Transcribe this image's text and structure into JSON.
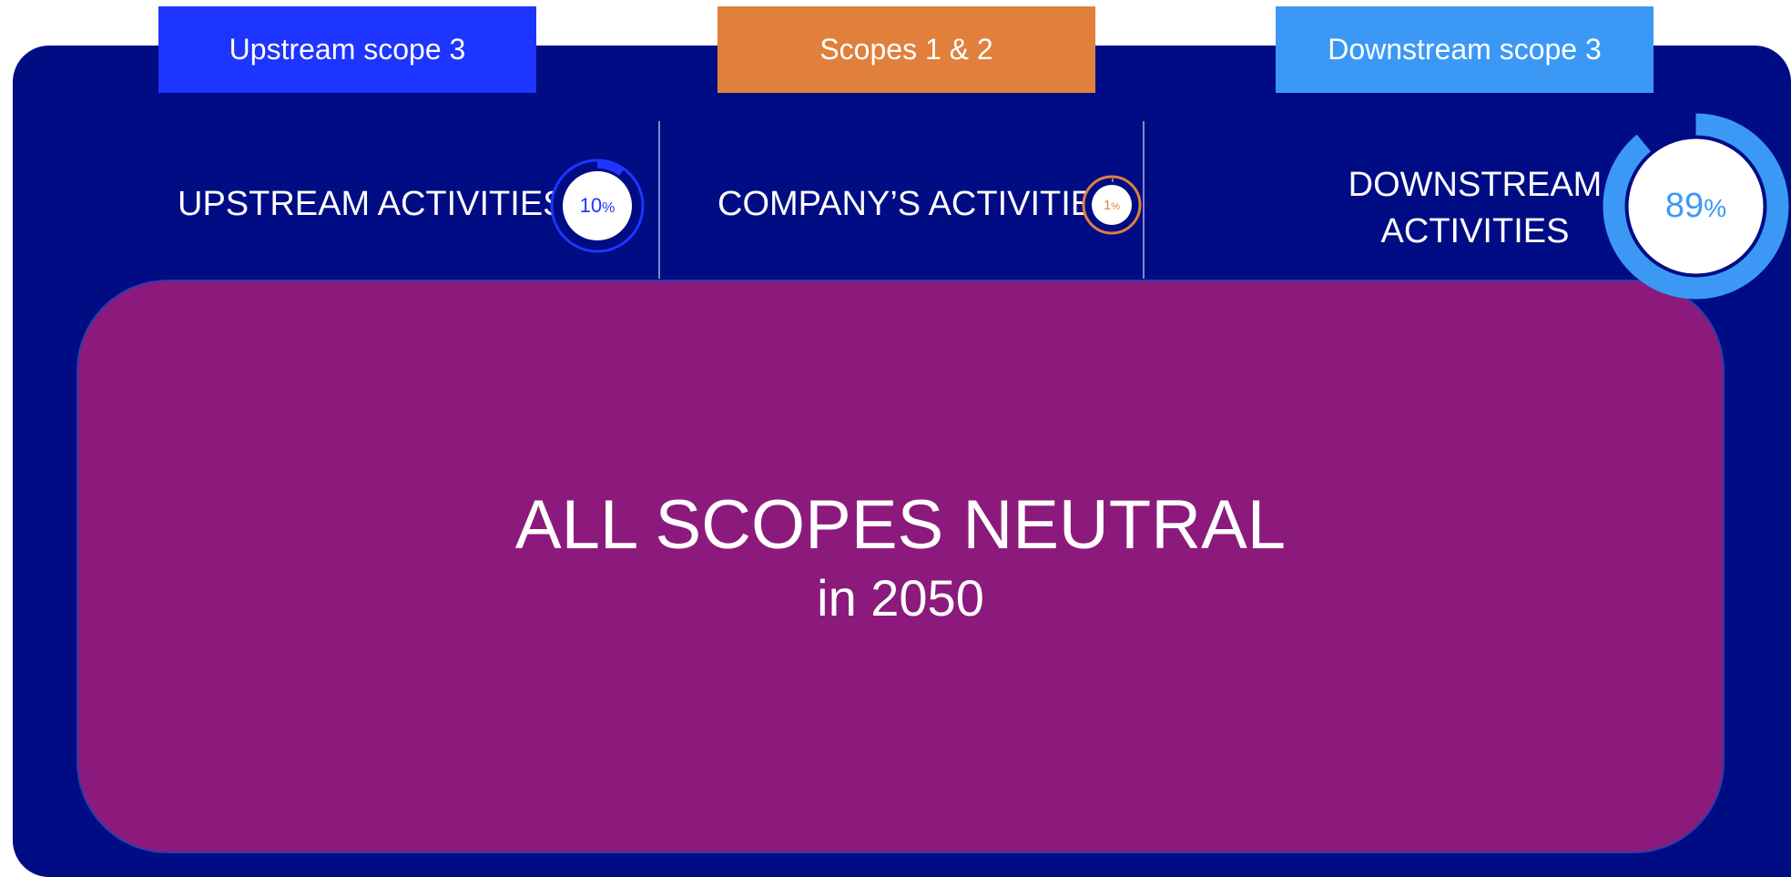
{
  "tabs": {
    "upstream": "Upstream scope 3",
    "company": "Scopes 1 & 2",
    "downstream": "Downstream scope 3"
  },
  "activities": {
    "upstream": {
      "label": "UPSTREAM ACTIVITIES",
      "value": "10",
      "unit": "%",
      "share": 0.1
    },
    "company": {
      "label": "COMPANY’S ACTIVITIES",
      "value": "1",
      "unit": "%",
      "share": 0.01
    },
    "downstream": {
      "label": "DOWNSTREAM ACTIVITIES",
      "value": "89",
      "unit": "%",
      "share": 0.89
    }
  },
  "goal": {
    "title": "ALL SCOPES NEUTRAL",
    "subtitle": "in 2050"
  },
  "colors": {
    "background_panel": "#000c84",
    "upstream": "#1e35ff",
    "company": "#e0803c",
    "downstream": "#3b99f5",
    "goal_box": "#8c1a7c"
  }
}
